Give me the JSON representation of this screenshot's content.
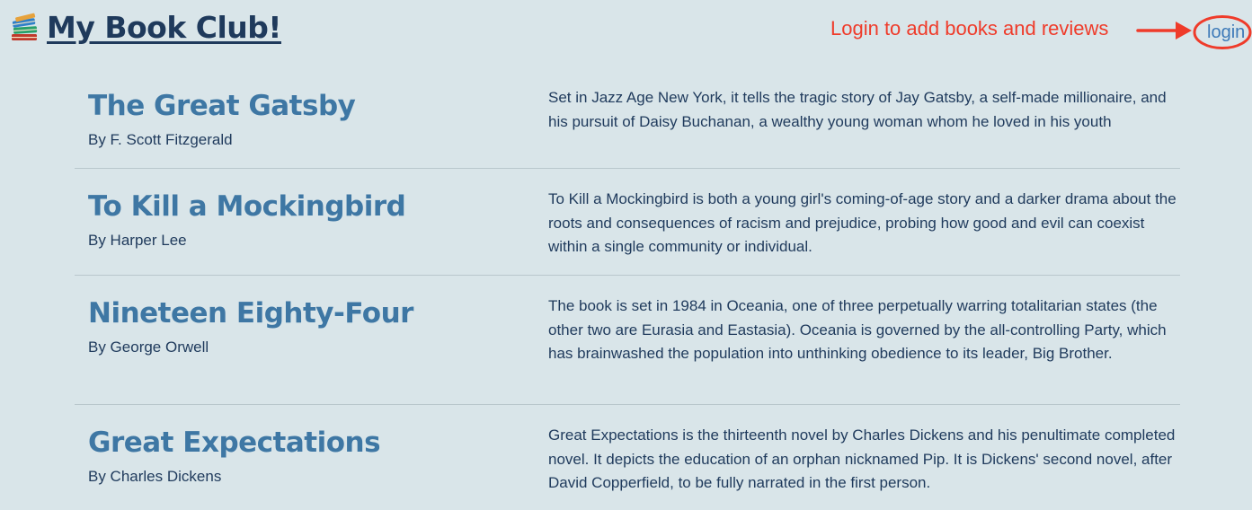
{
  "header": {
    "title": "My Book Club!",
    "icon": "books-icon"
  },
  "annotation": {
    "text": "Login to add books and reviews",
    "color": "#ef3b2a"
  },
  "nav": {
    "login_label": "login"
  },
  "books": [
    {
      "title": "The Great Gatsby",
      "author": "By F. Scott Fitzgerald",
      "description": "Set in Jazz Age New York, it tells the tragic story of Jay Gatsby, a self-made millionaire, and his pursuit of Daisy Buchanan, a wealthy young woman whom he loved in his youth"
    },
    {
      "title": "To Kill a Mockingbird",
      "author": "By Harper Lee",
      "description": "To Kill a Mockingbird is both a young girl's coming-of-age story and a darker drama about the roots and consequences of racism and prejudice, probing how good and evil can coexist within a single community or individual."
    },
    {
      "title": "Nineteen Eighty-Four",
      "author": "By George Orwell",
      "description": "The book is set in 1984 in Oceania, one of three perpetually warring totalitarian states (the other two are Eurasia and Eastasia). Oceania is governed by the all-controlling Party, which has brainwashed the population into unthinking obedience to its leader, Big Brother."
    },
    {
      "title": "Great Expectations",
      "author": "By Charles Dickens",
      "description": "Great Expectations is the thirteenth novel by Charles Dickens and his penultimate completed novel. It depicts the education of an orphan nicknamed Pip. It is Dickens' second novel, after David Copperfield, to be fully narrated in the first person."
    }
  ],
  "colors": {
    "background": "#d9e5e9",
    "title_text": "#1f3a5c",
    "book_title": "#3e77a4",
    "link": "#3d7ab8",
    "annotation": "#ef3b2a"
  }
}
